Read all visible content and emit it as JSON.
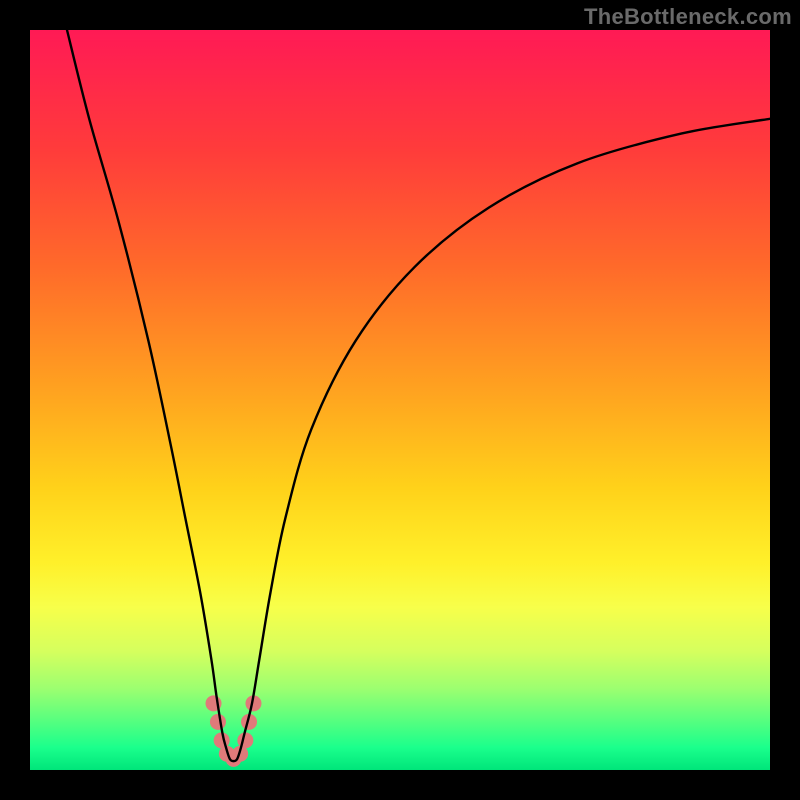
{
  "watermark": "TheBottleneck.com",
  "chart_data": {
    "type": "line",
    "title": "",
    "xlabel": "",
    "ylabel": "",
    "xlim": [
      0,
      100
    ],
    "ylim": [
      0,
      100
    ],
    "series": [
      {
        "name": "curve",
        "x": [
          5,
          8,
          12,
          16,
          19,
          21,
          23,
          24.5,
          25.2,
          26,
          26.5,
          27,
          27.5,
          28,
          28.5,
          29,
          30,
          31,
          32.5,
          34.5,
          38,
          44,
          52,
          62,
          74,
          88,
          100
        ],
        "y": [
          100,
          88,
          74,
          58,
          44,
          34,
          24,
          15,
          10,
          5,
          3,
          1.5,
          1.2,
          1.5,
          3,
          5,
          9,
          15,
          24,
          34,
          46,
          58,
          68,
          76,
          82,
          86,
          88
        ],
        "color": "#000000"
      }
    ],
    "markers": [
      {
        "x": 24.8,
        "y": 9.0,
        "color": "#e07a7a",
        "r": 8
      },
      {
        "x": 25.4,
        "y": 6.5,
        "color": "#e07a7a",
        "r": 8
      },
      {
        "x": 25.9,
        "y": 4.0,
        "color": "#e07a7a",
        "r": 8
      },
      {
        "x": 26.6,
        "y": 2.2,
        "color": "#e07a7a",
        "r": 8
      },
      {
        "x": 27.5,
        "y": 1.5,
        "color": "#e07a7a",
        "r": 8
      },
      {
        "x": 28.4,
        "y": 2.2,
        "color": "#e07a7a",
        "r": 8
      },
      {
        "x": 29.1,
        "y": 4.0,
        "color": "#e07a7a",
        "r": 8
      },
      {
        "x": 29.6,
        "y": 6.5,
        "color": "#e07a7a",
        "r": 8
      },
      {
        "x": 30.2,
        "y": 9.0,
        "color": "#e07a7a",
        "r": 8
      }
    ]
  }
}
